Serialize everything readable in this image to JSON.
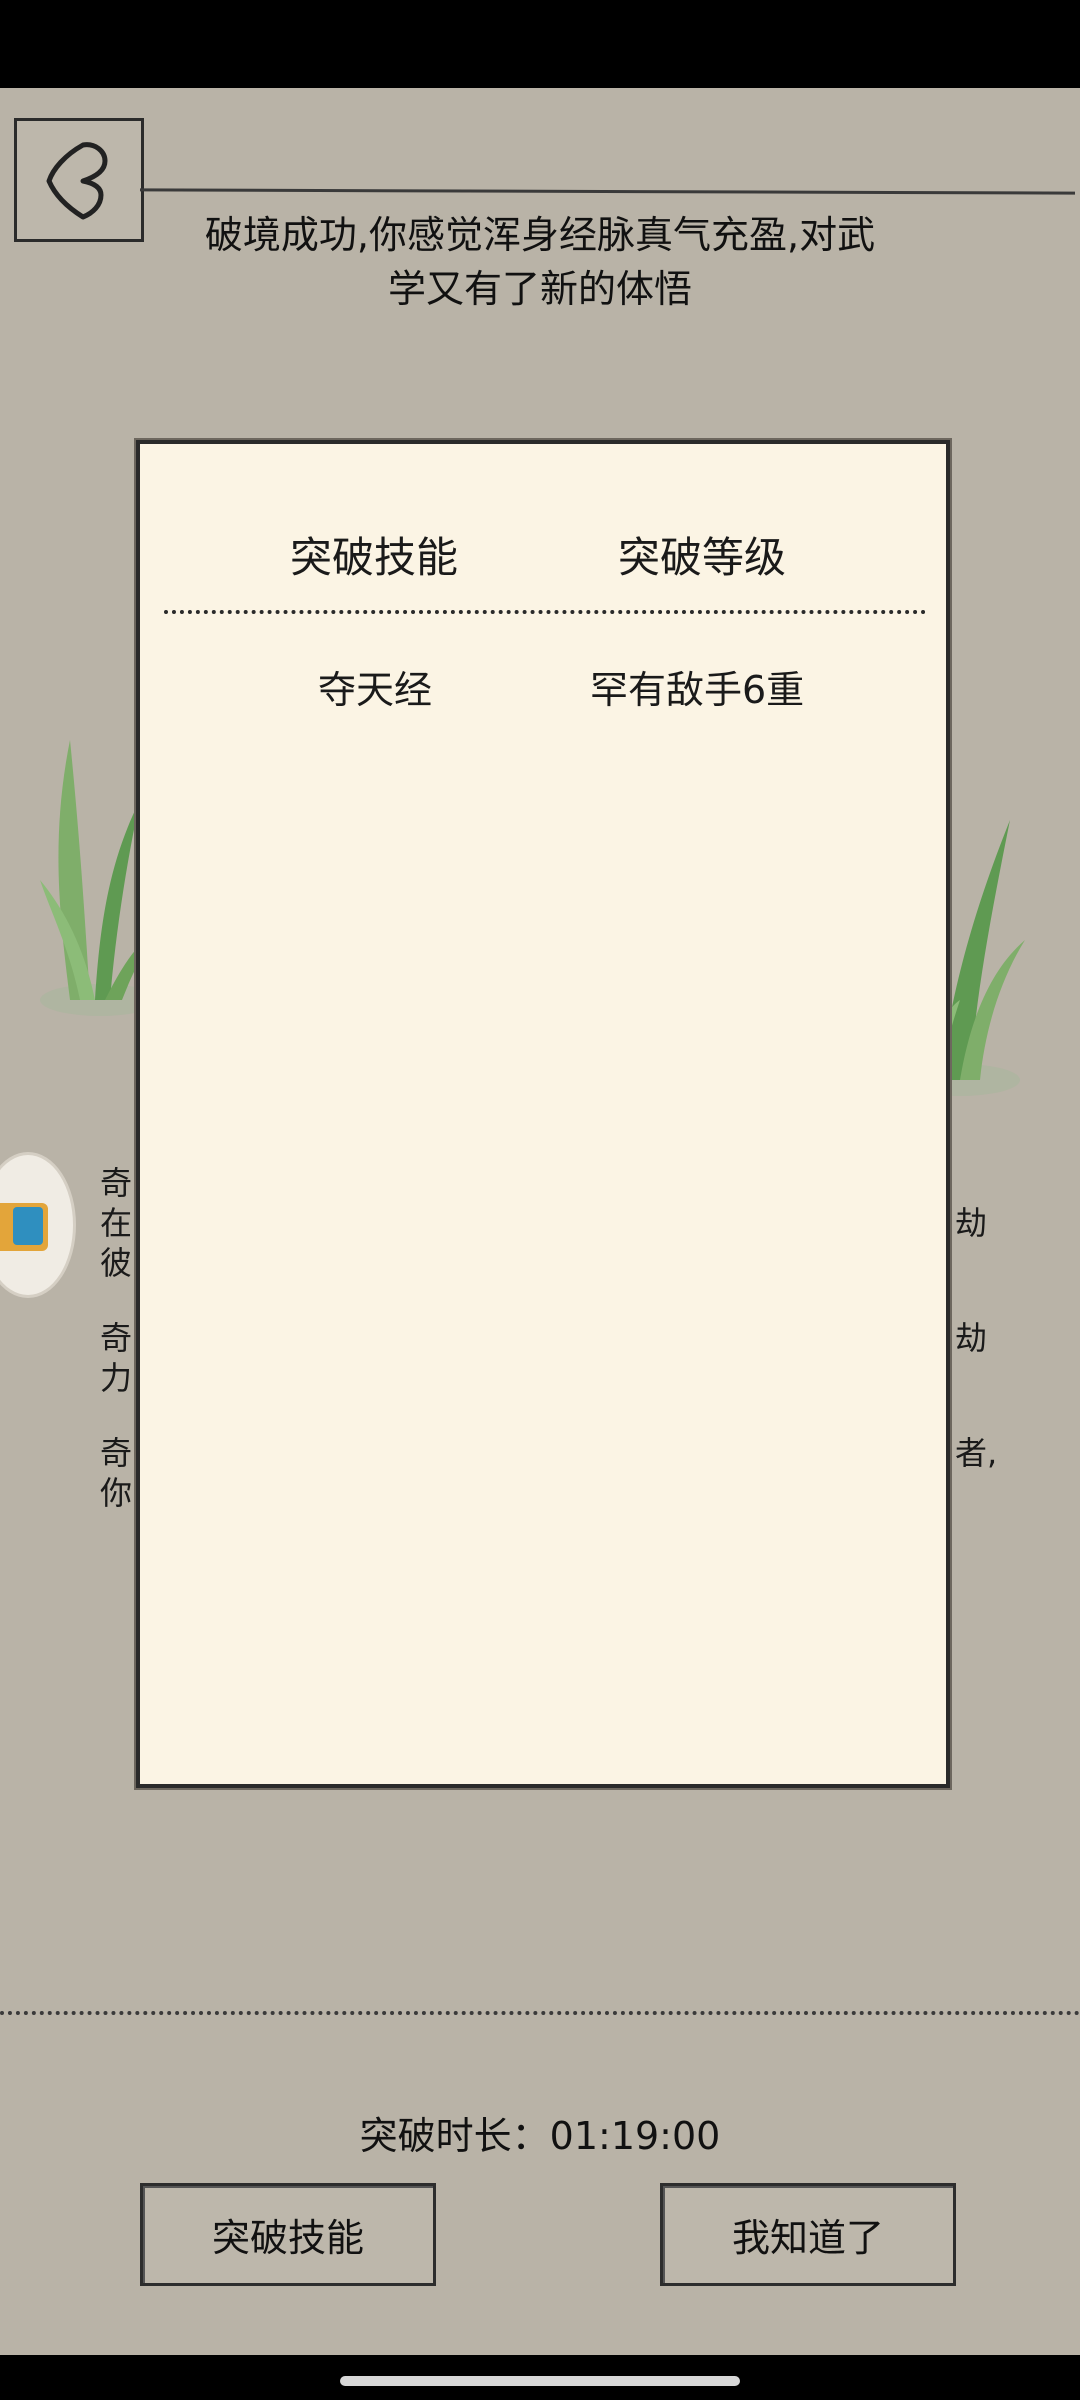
{
  "message": {
    "line1": "破境成功,你感觉浑身经脉真气充盈,对武",
    "line2": "学又有了新的体悟"
  },
  "background_text": {
    "left": [
      "奇",
      "在",
      "彼",
      "奇",
      "力",
      "奇",
      "你"
    ],
    "right": [
      "劫",
      "劫",
      "者,"
    ]
  },
  "modal": {
    "headers": {
      "skill": "突破技能",
      "level": "突破等级"
    },
    "rows": [
      {
        "skill": "夺天经",
        "level": "罕有敌手6重"
      }
    ]
  },
  "duration": "突破时长：01:19:00",
  "buttons": {
    "breakthrough_skill": "突破技能",
    "got_it": "我知道了"
  },
  "colors": {
    "background": "#b9b3a7",
    "panel": "#fbf4e4",
    "ink": "#1a1a1a",
    "grass": "#6ea35a"
  },
  "icons": {
    "back": "back-arrow-icon"
  }
}
